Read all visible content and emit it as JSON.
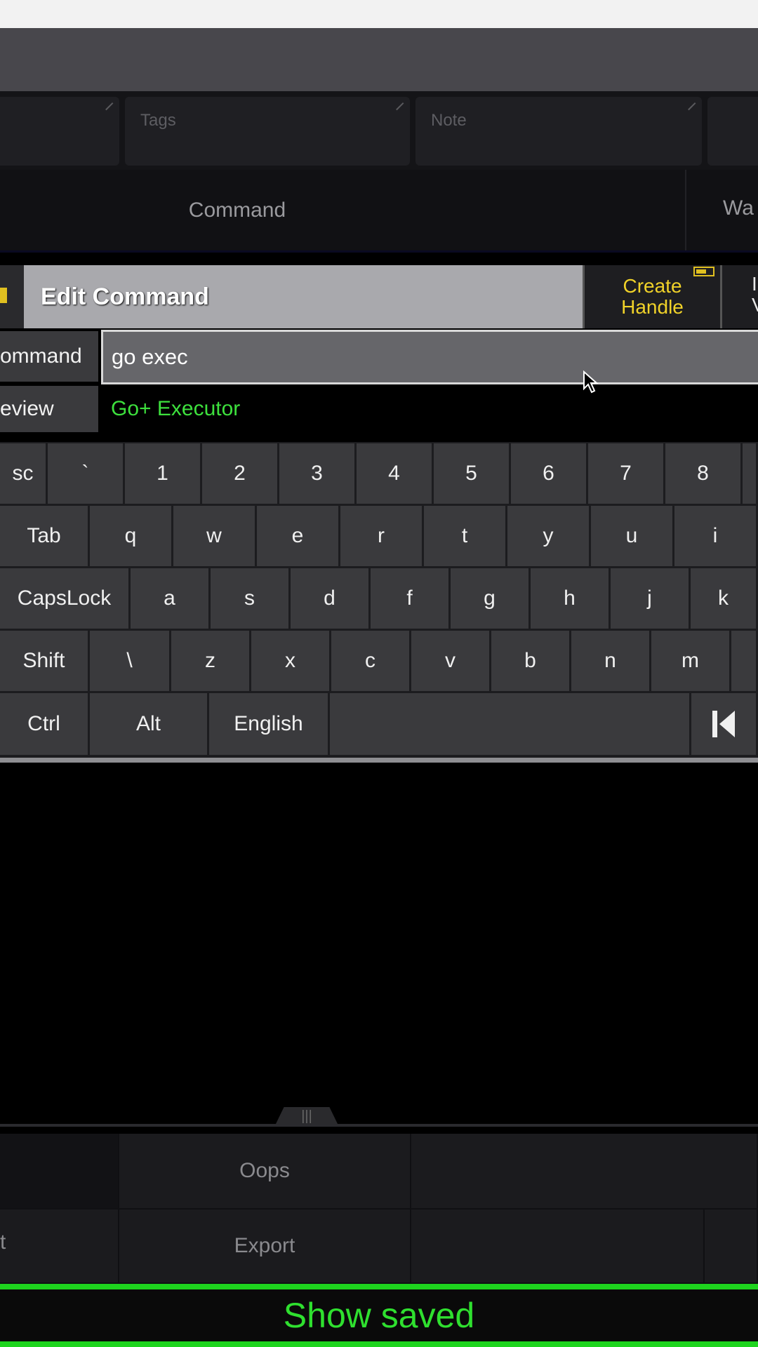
{
  "fields": {
    "tags_label": "Tags",
    "note_label": "Note"
  },
  "tabs": {
    "command": "Command",
    "partial_right": "Wa"
  },
  "edit": {
    "title": "Edit Command",
    "create_handle_line1": "Create",
    "create_handle_line2": "Handle",
    "partial_right_line1": "I",
    "partial_right_line2": "V"
  },
  "command_row": {
    "label": "ommand",
    "value": "go exec"
  },
  "preview_row": {
    "label": "eview",
    "value": "Go+ Executor"
  },
  "keyboard": {
    "row1": [
      "sc",
      "`",
      "1",
      "2",
      "3",
      "4",
      "5",
      "6",
      "7",
      "8"
    ],
    "row2": [
      "Tab",
      "q",
      "w",
      "e",
      "r",
      "t",
      "y",
      "u",
      "i"
    ],
    "row3": [
      "CapsLock",
      "a",
      "s",
      "d",
      "f",
      "g",
      "h",
      "j",
      "k"
    ],
    "row4": [
      "Shift",
      "\\",
      "z",
      "x",
      "c",
      "v",
      "b",
      "n",
      "m"
    ],
    "row5": [
      "Ctrl",
      "Alt",
      "English",
      ""
    ]
  },
  "bottom": {
    "oops": "Oops",
    "export": "Export",
    "left_partial": "t"
  },
  "status": {
    "text": "Show saved"
  },
  "colors": {
    "accent_green": "#1ed41e",
    "accent_yellow": "#f0d229"
  }
}
